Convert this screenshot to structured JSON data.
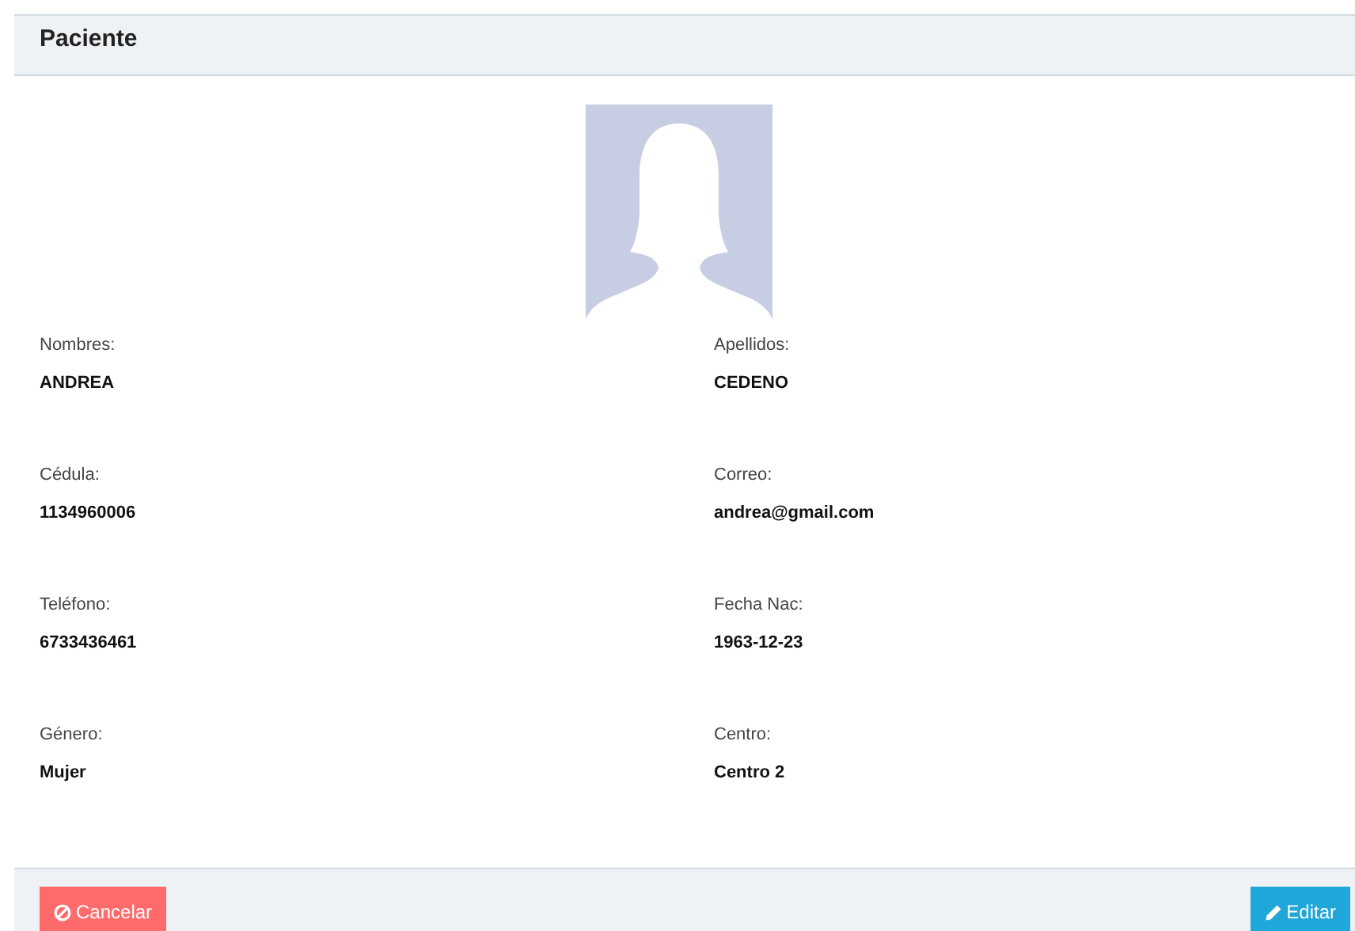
{
  "header": {
    "title": "Paciente"
  },
  "fields": [
    {
      "label": "Nombres:",
      "value": "ANDREA"
    },
    {
      "label": "Apellidos:",
      "value": "CEDENO"
    },
    {
      "label": "Cédula:",
      "value": "1134960006"
    },
    {
      "label": "Correo:",
      "value": "andrea@gmail.com"
    },
    {
      "label": "Teléfono:",
      "value": "6733436461"
    },
    {
      "label": "Fecha Nac:",
      "value": "1963-12-23"
    },
    {
      "label": "Género:",
      "value": "Mujer"
    },
    {
      "label": "Centro:",
      "value": "Centro 2"
    }
  ],
  "footer": {
    "buttons": [
      {
        "label": "Cancelar",
        "kind": "cancel"
      },
      {
        "label": "Editar",
        "kind": "edit"
      }
    ]
  }
}
